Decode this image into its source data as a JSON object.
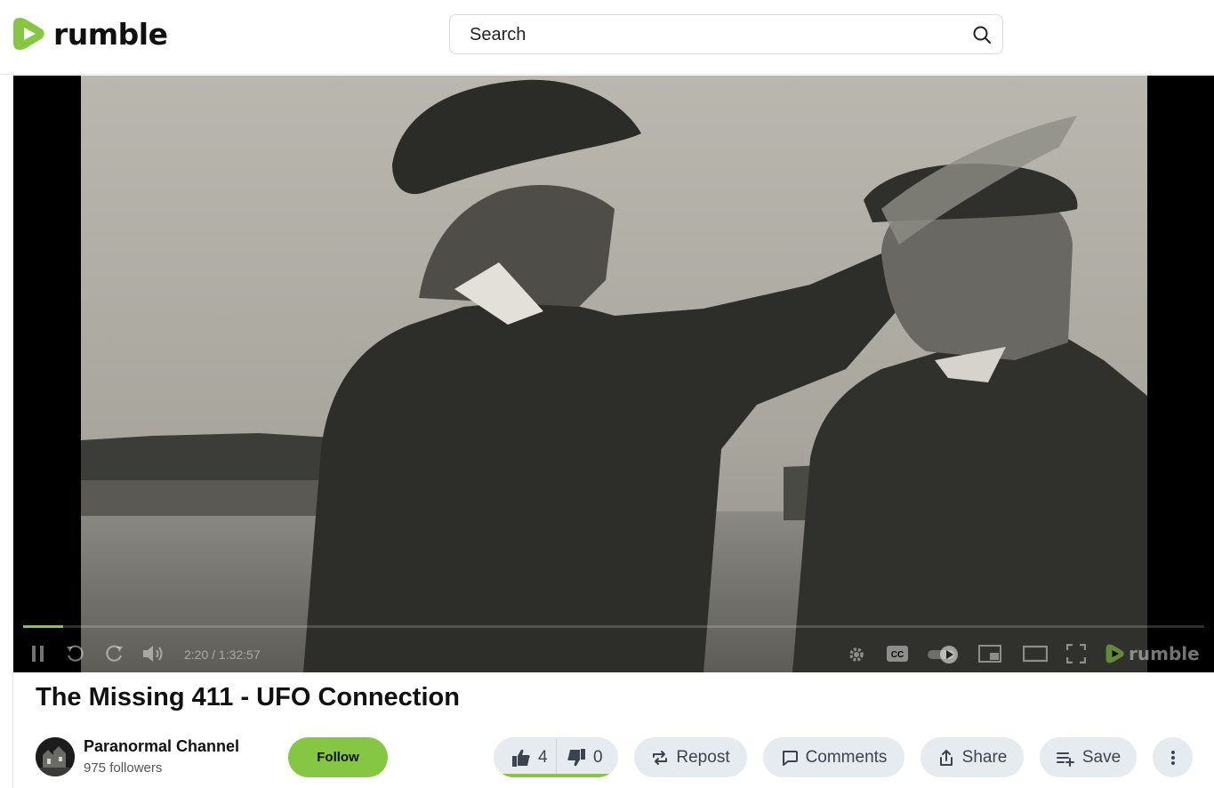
{
  "header": {
    "brand": "rumble",
    "search_placeholder": "Search"
  },
  "player": {
    "time_display": "2:20 / 1:32:57",
    "progress_fraction": 0.034,
    "watermark": "rumble"
  },
  "video": {
    "title": "The Missing 411 - UFO Connection"
  },
  "channel": {
    "name": "Paranormal Channel",
    "followers": "975 followers",
    "follow_label": "Follow"
  },
  "actions": {
    "likes": "4",
    "dislikes": "0",
    "repost_label": "Repost",
    "comments_label": "Comments",
    "share_label": "Share",
    "save_label": "Save"
  },
  "colors": {
    "brand_green": "#85c742",
    "pill_bg": "#e6ebf0"
  }
}
